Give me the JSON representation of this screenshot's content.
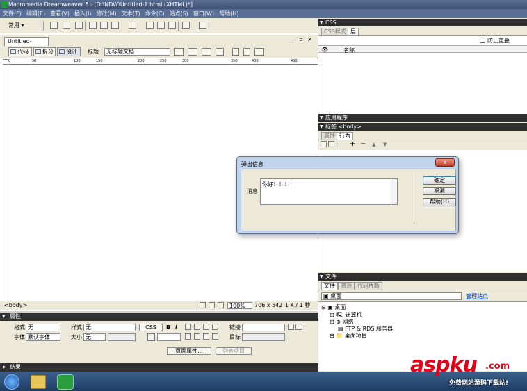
{
  "window": {
    "title": "Macromedia Dreamweaver 8 - [D:\\NDW\\Untitled-1.html (XHTML)*]"
  },
  "menu": [
    "文件(F)",
    "编辑(E)",
    "查看(V)",
    "插入(I)",
    "修改(M)",
    "文本(T)",
    "命令(C)",
    "站点(S)",
    "窗口(W)",
    "帮助(H)"
  ],
  "insert_bar": {
    "category": "常用"
  },
  "document": {
    "tab": "Untitled-1.html*",
    "view_buttons": [
      "代码",
      "拆分",
      "设计"
    ],
    "title_label": "标题:",
    "title_value": "无标题文档",
    "ruler_marks": [
      "0",
      "50",
      "100",
      "150",
      "200",
      "250",
      "300",
      "350",
      "400",
      "450"
    ],
    "status": {
      "tag": "<body>",
      "zoom": "100%",
      "size": "706 x 542",
      "weight": "1 K / 1 秒"
    }
  },
  "properties": {
    "header": "属性",
    "format_label": "格式",
    "format_value": "无",
    "style_label": "样式",
    "style_value": "无",
    "css_button": "CSS",
    "bold": "B",
    "italic": "I",
    "link_label": "链接",
    "font_label": "字体",
    "font_value": "默认字体",
    "size_label": "大小",
    "size_value": "无",
    "target_label": "目标",
    "page_props_button": "页面属性...",
    "list_item_button": "列表项目"
  },
  "results": {
    "header": "结果"
  },
  "right": {
    "css": {
      "header": "CSS",
      "tabs": [
        "CSS样式",
        "层"
      ],
      "prevent_overlap": "防止重叠",
      "col_name": "名称"
    },
    "app": {
      "header": "应用程序"
    },
    "tag": {
      "header": "标签 <body>",
      "tabs": [
        "属性",
        "行为"
      ],
      "buttons": [
        "+",
        "−",
        "▲",
        "▼"
      ]
    },
    "files": {
      "header": "文件",
      "tabs": [
        "文件",
        "资源",
        "代码片断"
      ],
      "location": "桌面",
      "manage": "管理站点",
      "tree": [
        "桌面",
        "计算机",
        "网络",
        "FTP & RDS 服务器",
        "桌面项目"
      ]
    }
  },
  "dialog": {
    "title": "弹出信息",
    "close": "x",
    "label": "消息",
    "message": "你好！！！|",
    "buttons": [
      "确定",
      "取消",
      "帮助(H)"
    ]
  },
  "watermark": {
    "brand": "aspku",
    "domain": ".com",
    "slogan": "免费网站源码下载站!"
  },
  "colors": {
    "panel_header": "#2e2e2e",
    "dialog_frame": "#bfd3ea",
    "taskbar": "#1d3c64",
    "watermark_red": "#e3001b"
  }
}
